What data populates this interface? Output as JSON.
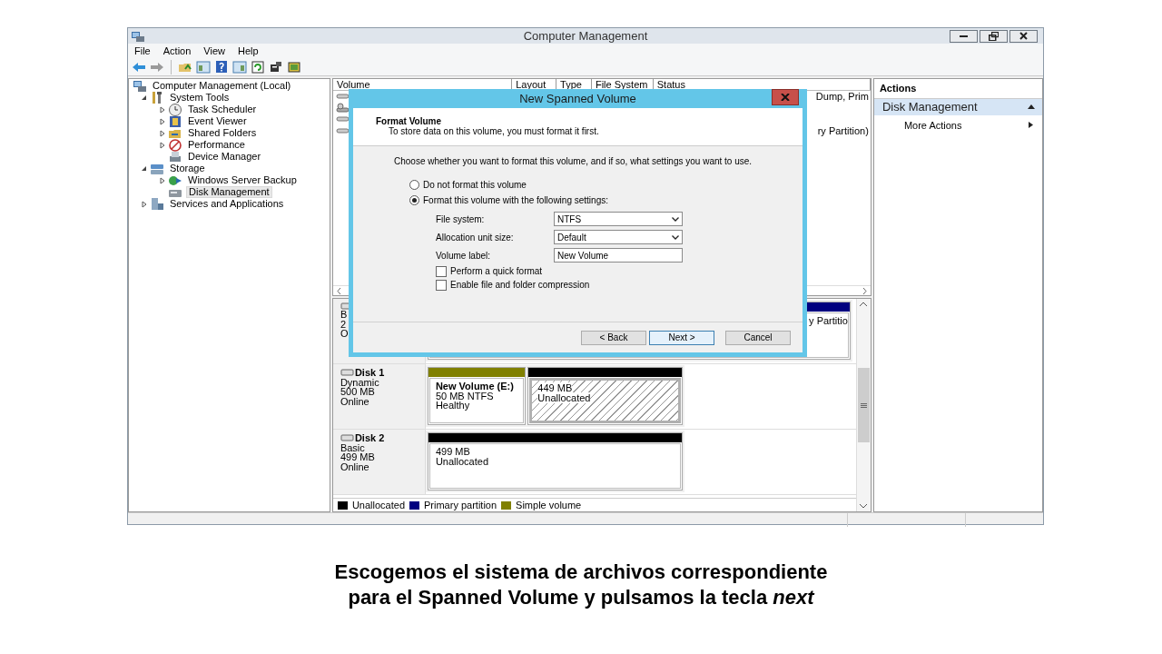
{
  "window": {
    "title": "Computer Management"
  },
  "menu": [
    "File",
    "Action",
    "View",
    "Help"
  ],
  "tree": [
    {
      "label": "Computer Management (Local)",
      "kind": "computer",
      "selected": false,
      "children": [
        {
          "label": "System Tools",
          "kind": "tools",
          "expanded": true,
          "selected": false,
          "children": [
            {
              "label": "Task Scheduler",
              "kind": "clock",
              "expanded": false,
              "selected": false
            },
            {
              "label": "Event Viewer",
              "kind": "log",
              "expanded": false,
              "selected": false
            },
            {
              "label": "Shared Folders",
              "kind": "share",
              "expanded": false,
              "selected": false
            },
            {
              "label": "Performance",
              "kind": "perf",
              "expanded": false,
              "selected": false
            },
            {
              "label": "Device Manager",
              "kind": "device",
              "selected": false
            }
          ]
        },
        {
          "label": "Storage",
          "kind": "storage",
          "expanded": true,
          "selected": false,
          "children": [
            {
              "label": "Windows Server Backup",
              "kind": "backup",
              "expanded": false,
              "selected": false
            },
            {
              "label": "Disk Management",
              "kind": "disk",
              "selected": true
            }
          ]
        },
        {
          "label": "Services and Applications",
          "kind": "services",
          "expanded": false,
          "selected": false
        }
      ]
    }
  ],
  "volume_list": {
    "columns": [
      "Volume",
      "Layout",
      "Type",
      "File System",
      "Status"
    ],
    "rows": [
      {
        "kind": "basic",
        "status": "Dump, Prim"
      },
      {
        "kind": "system"
      },
      {
        "kind": "basic"
      },
      {
        "kind": "basic",
        "status": "ry Partition)"
      }
    ]
  },
  "disks": [
    {
      "type": "B",
      "size": "2",
      "status": "O",
      "partitions": [
        {
          "color": "#000080",
          "selected": false,
          "lines": [
            "y Partitio"
          ]
        }
      ]
    },
    {
      "name": "Disk 1",
      "type": "Dynamic",
      "size": "500 MB",
      "status": "Online",
      "partitions": [
        {
          "color": "#808000",
          "selected": false,
          "name": "New Volume  (E:)",
          "lines": [
            "50 MB NTFS",
            "Healthy"
          ]
        },
        {
          "color": "#000000",
          "selected": true,
          "lines": [
            "449 MB",
            "Unallocated"
          ]
        }
      ]
    },
    {
      "name": "Disk 2",
      "type": "Basic",
      "size": "499 MB",
      "status": "Online",
      "partitions": [
        {
          "color": "#000000",
          "selected": false,
          "lines": [
            "499 MB",
            "Unallocated"
          ]
        }
      ]
    }
  ],
  "legend": [
    {
      "label": "Unallocated",
      "color": "#000000"
    },
    {
      "label": "Primary partition",
      "color": "#000080"
    },
    {
      "label": "Simple volume",
      "color": "#808000"
    }
  ],
  "actions": {
    "header": "Actions",
    "groups": [
      {
        "title": "Disk Management",
        "expanded": true,
        "items": [
          {
            "label": "More Actions"
          }
        ]
      }
    ]
  },
  "dialog": {
    "title": "New Spanned Volume",
    "heading": "Format Volume",
    "subheading": "To store data on this volume, you must format it first.",
    "instruction": "Choose whether you want to format this volume, and if so, what settings you want to use.",
    "options": [
      {
        "label": "Do not format this volume",
        "selected": false
      },
      {
        "label": "Format this volume with the following settings:",
        "selected": true
      }
    ],
    "fields": [
      {
        "label": "File system:",
        "kind": "dropdown",
        "value": "NTFS"
      },
      {
        "label": "Allocation unit size:",
        "kind": "dropdown",
        "value": "Default"
      },
      {
        "label": "Volume label:",
        "kind": "text",
        "value": "New Volume"
      }
    ],
    "checkboxes": [
      {
        "label": "Perform a quick format",
        "checked": false
      },
      {
        "label": "Enable file and folder compression",
        "checked": false
      }
    ],
    "buttons": [
      {
        "label": "< Back",
        "default": false
      },
      {
        "label": "Next >",
        "default": true
      },
      {
        "label": "Cancel",
        "default": false
      }
    ]
  },
  "caption": [
    "Escogemos el sistema de archivos correspondiente",
    "para el Spanned Volume y pulsamos la tecla *next*"
  ]
}
